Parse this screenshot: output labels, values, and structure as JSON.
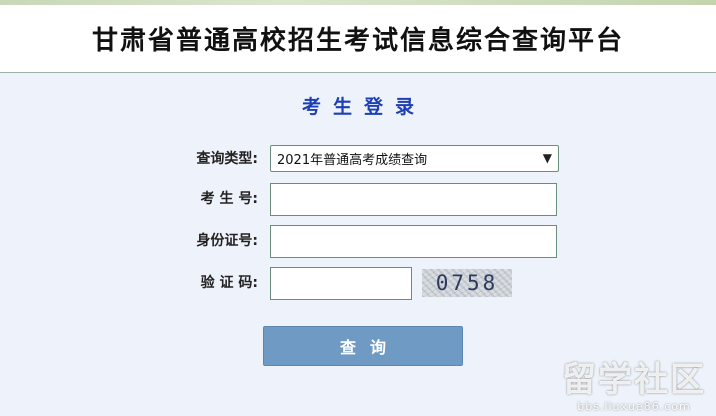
{
  "header": {
    "title": "甘肃省普通高校招生考试信息综合查询平台"
  },
  "login": {
    "title": "考生登录",
    "query_type_label": "查询类型:",
    "query_type_selected": "2021年普通高考成绩查询",
    "exam_number_label": "考 生 号:",
    "id_number_label": "身份证号:",
    "captcha_label": "验 证 码:",
    "captcha_value": "0758",
    "submit_label": "查询"
  },
  "watermark": {
    "main": "留学社区",
    "url": "bbs.liuxue86.com"
  },
  "colors": {
    "background": "#eef3fb",
    "title_blue": "#1d3fb5",
    "button": "#6f9ac4",
    "input_border": "#6c8c7c"
  }
}
